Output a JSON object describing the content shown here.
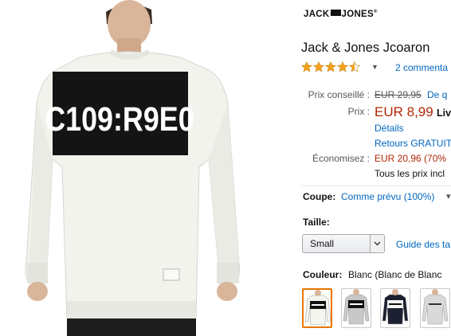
{
  "brand": {
    "logo_text_left": "JACK",
    "logo_text_right": "JONES",
    "registered": "®"
  },
  "product": {
    "title": "Jack & Jones Jcoaron",
    "print_text": "C109:R9E0",
    "rating": 4.4,
    "reviews_label": "2 commenta"
  },
  "pricing": {
    "list_label": "Prix conseillé :",
    "list_price": "EUR 29,95",
    "list_suffix": "De q",
    "price_label": "Prix :",
    "price": "EUR 8,99",
    "price_suffix": "Liv",
    "details_link": "Détails",
    "returns_link": "Retours GRATUIT",
    "savings_label": "Économisez :",
    "savings": "EUR 20,96 (70%",
    "tax_note": "Tous les prix incl"
  },
  "fit": {
    "label": "Coupe:",
    "value": "Comme prévu (100%)",
    "arrow": "▾"
  },
  "size": {
    "label": "Taille:",
    "selected": "Small",
    "guide_link": "Guide des ta"
  },
  "color": {
    "label": "Couleur:",
    "value": "Blanc (Blanc de Blanc",
    "swatches": [
      {
        "name": "white",
        "body": "#f5f5f0",
        "band": "#111111",
        "text": "#ffffff"
      },
      {
        "name": "grey",
        "body": "#c8c8c8",
        "band": "#111111",
        "text": "#ffffff"
      },
      {
        "name": "navy",
        "body": "#1c2030",
        "band": "#f5f5f5",
        "text": "#111111"
      },
      {
        "name": "light-grey",
        "body": "#d9d9d9",
        "band": "#d9d9d9",
        "text": "#333333"
      }
    ]
  },
  "colors": {
    "link": "#0066c0",
    "price": "#b12704",
    "star": "#f7a21b",
    "selected_border": "#e77600"
  }
}
